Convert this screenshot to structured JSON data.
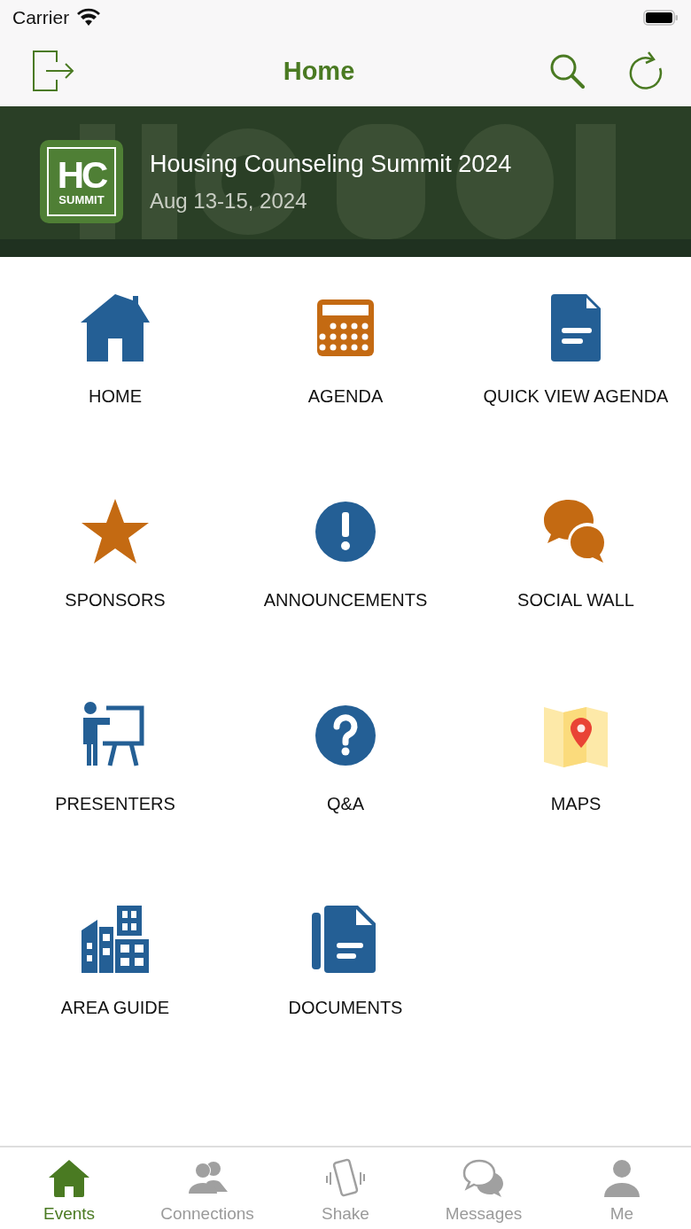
{
  "status_bar": {
    "carrier": "Carrier"
  },
  "nav": {
    "title": "Home"
  },
  "event": {
    "logo": {
      "top": "HC",
      "bottom": "SUMMIT"
    },
    "title": "Housing Counseling Summit 2024",
    "dates": "Aug 13-15, 2024"
  },
  "tiles": [
    {
      "kind": "home",
      "label": "HOME"
    },
    {
      "kind": "calendar",
      "label": "AGENDA"
    },
    {
      "kind": "document",
      "label": "QUICK VIEW AGENDA"
    },
    {
      "kind": "star",
      "label": "SPONSORS"
    },
    {
      "kind": "alert",
      "label": "ANNOUNCEMENTS"
    },
    {
      "kind": "chat",
      "label": "SOCIAL WALL"
    },
    {
      "kind": "presenter",
      "label": "PRESENTERS"
    },
    {
      "kind": "question",
      "label": "Q&A"
    },
    {
      "kind": "map",
      "label": "MAPS"
    },
    {
      "kind": "buildings",
      "label": "AREA GUIDE"
    },
    {
      "kind": "file",
      "label": "DOCUMENTS"
    }
  ],
  "tab_bar": [
    {
      "kind": "events",
      "label": "Events",
      "selected": true
    },
    {
      "kind": "connections",
      "label": "Connections",
      "selected": false
    },
    {
      "kind": "shake",
      "label": "Shake",
      "selected": false
    },
    {
      "kind": "messages",
      "label": "Messages",
      "selected": false
    },
    {
      "kind": "me",
      "label": "Me",
      "selected": false
    }
  ]
}
